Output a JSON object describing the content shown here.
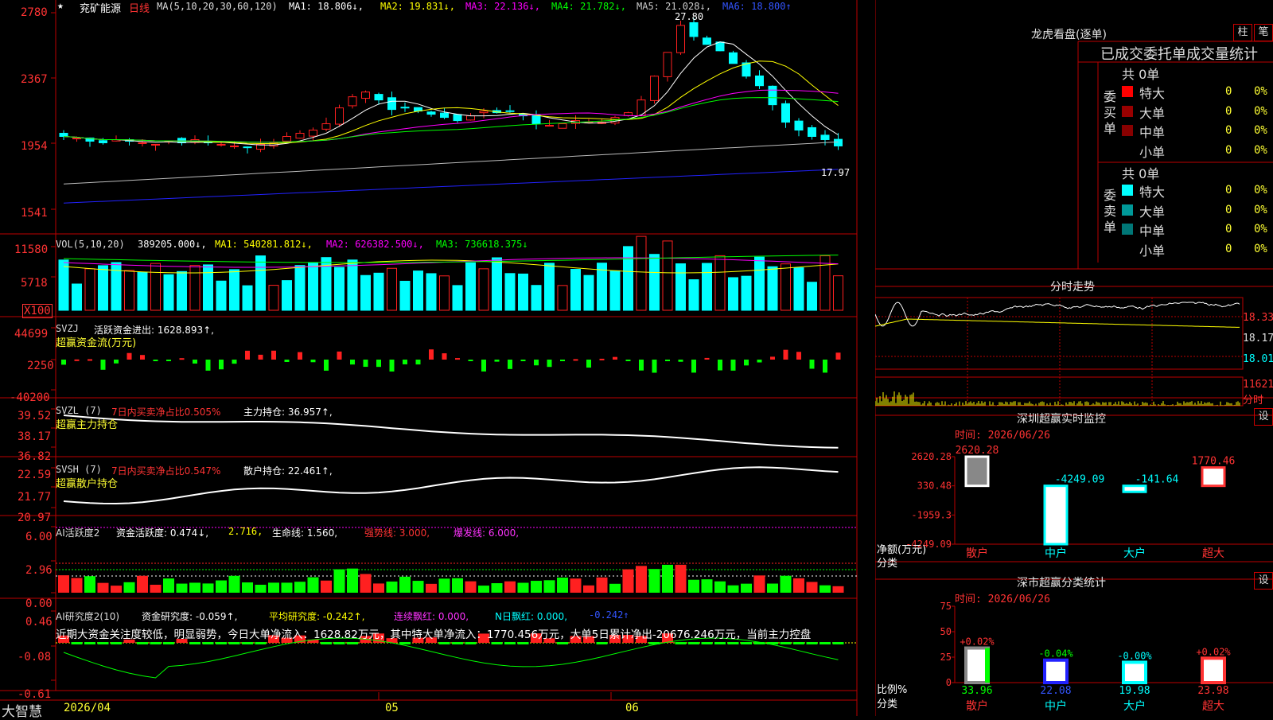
{
  "colors": {
    "up": "#ff2020",
    "down": "#00ffff",
    "green": "#00ff00",
    "grid": "#bb0000",
    "yellow": "#ffff00",
    "white": "#ffffff",
    "magenta": "#ff00ff",
    "blue": "#2222ff"
  },
  "header": {
    "star": "★",
    "stock_name": "兖矿能源",
    "period": "日线",
    "ma_params": "MA(5,10,20,30,60,120)",
    "ma1": "MA1: 18.806↓,",
    "ma2": "MA2: 19.831↓,",
    "ma3": "MA3: 22.136↓,",
    "ma4": "MA4: 21.782↓,",
    "ma5": "MA5: 21.028↓,",
    "ma6": "MA6: 18.800↑"
  },
  "price_panel": {
    "y_ticks": [
      "2780",
      "2367",
      "1954",
      "1541"
    ],
    "high_label": "27.80",
    "low_label": "17.97"
  },
  "vol_panel": {
    "label": "VOL(5,10,20)",
    "value": "389205.000↓,",
    "ma1": "MA1: 540281.812↓,",
    "ma2": "MA2: 626382.500↓,",
    "ma3": "MA3: 736618.375↓",
    "y_ticks": [
      "11580",
      "5718"
    ],
    "unit": "X100"
  },
  "svzj_panel": {
    "label": "SVZJ",
    "text1": "活跃资金进出: 1628.893↑,",
    "text2": "超赢资金流(万元)",
    "y_ticks": [
      "44699",
      "2250",
      "-40200"
    ]
  },
  "svzl_panel": {
    "label": "SVZL (7)",
    "text1": "7日内买卖净占比0.505%",
    "text2": "主力持仓: 36.957↑,",
    "text3": "超赢主力持仓",
    "y_ticks": [
      "39.52",
      "38.17",
      "36.82"
    ]
  },
  "svsh_panel": {
    "label": "SVSH (7)",
    "text1": "7日内买卖净占比0.547%",
    "text2": "散户持仓: 22.461↑,",
    "text3": "超赢散户持仓",
    "y_ticks": [
      "22.59",
      "21.77",
      "20.97"
    ]
  },
  "ai1_panel": {
    "label": "AI活跃度2",
    "text1": "资金活跃度: 0.474↓,",
    "text2": "2.716,",
    "text3": "生命线: 1.560,",
    "text4": "强势线: 3.000,",
    "text5": "爆发线: 6.000,",
    "y_ticks": [
      "6.00",
      "2.96",
      "0.00"
    ]
  },
  "ai2_panel": {
    "label": "AI研究度2(10)",
    "text1": "资金研究度: -0.059↑,",
    "text2": "平均研究度: -0.242↑,",
    "text3": "连续飘红: 0.000,",
    "text4": "N日飘红: 0.000,",
    "text5": "-0.242↑",
    "comment": "近期大资金关注度较低，明显弱势，今日大单净流入：1628.82万元，其中特大单净流入：1770.456万元，大单5日累计净出-20676.246万元，当前主力控盘",
    "y_ticks": [
      "0.46",
      "-0.08",
      "-0.61"
    ]
  },
  "footer": {
    "brand": "大智慧",
    "dates": [
      "2026/04",
      "05",
      "06"
    ]
  },
  "dragon": {
    "title": "龙虎看盘(逐单)",
    "btn1": "柱",
    "btn2": "笔",
    "subtitle": "已成交委托单成交量统计",
    "buy": {
      "side": "委买单",
      "count": "共 0单",
      "rows": [
        {
          "label": "特大",
          "v": "0",
          "p": "0%",
          "c": "#ff0000"
        },
        {
          "label": "大单",
          "v": "0",
          "p": "0%",
          "c": "#990000"
        },
        {
          "label": "中单",
          "v": "0",
          "p": "0%",
          "c": "#880000"
        },
        {
          "label": "小单",
          "v": "0",
          "p": "0%",
          "c": "#000000"
        }
      ]
    },
    "sell": {
      "side": "委卖单",
      "count": "共 0单",
      "rows": [
        {
          "label": "特大",
          "v": "0",
          "p": "0%",
          "c": "#00ffff"
        },
        {
          "label": "大单",
          "v": "0",
          "p": "0%",
          "c": "#009999"
        },
        {
          "label": "中单",
          "v": "0",
          "p": "0%",
          "c": "#007777"
        },
        {
          "label": "小单",
          "v": "0",
          "p": "0%",
          "c": "#000000"
        }
      ]
    }
  },
  "intraday": {
    "title": "分时走势",
    "y_ticks": [
      "18.33",
      "18.17",
      "18.01"
    ],
    "vol_label": "11621",
    "vol_unit": "分时"
  },
  "monitor": {
    "title": "深圳超赢实时监控",
    "btn": "设",
    "time": "时间: 2026/06/26",
    "y_ticks": [
      "2620.28",
      "330.48",
      "-1959.3",
      "-4249.09"
    ],
    "ylabel1": "净额(万元)",
    "ylabel2": "分类",
    "categories": [
      "散户",
      "中户",
      "大户",
      "超大"
    ],
    "values": [
      2620.28,
      -4249.09,
      -141.64,
      1770.46
    ],
    "value_labels": [
      "2620.28",
      "-4249.09",
      "-141.64",
      "1770.46"
    ]
  },
  "classify": {
    "title": "深市超赢分类统计",
    "btn": "设",
    "time": "时间: 2026/06/26",
    "y_ticks": [
      "75",
      "50",
      "25",
      "0"
    ],
    "ylabel1": "比例%",
    "ylabel2": "分类",
    "categories": [
      "散户",
      "中户",
      "大户",
      "超大"
    ],
    "values": [
      33.96,
      22.08,
      19.98,
      23.98
    ],
    "changes": [
      "+0.02%",
      "-0.04%",
      "-0.00%",
      "+0.02%"
    ]
  },
  "chart_data": {
    "type": "candlestick",
    "x_labels": [
      "2026/04",
      "05",
      "06"
    ],
    "ylim": [
      15.41,
      27.8
    ],
    "price": {
      "high": 27.8,
      "low": 17.97
    },
    "ma_last": {
      "MA1": 18.806,
      "MA2": 19.831,
      "MA3": 22.136,
      "MA4": 21.782,
      "MA5": 21.028,
      "MA6": 18.8
    },
    "volume_last": 389205.0,
    "monitor_values": [
      2620.28,
      -4249.09,
      -141.64,
      1770.46
    ],
    "classify_values": [
      33.96,
      22.08,
      19.98,
      23.98
    ]
  }
}
